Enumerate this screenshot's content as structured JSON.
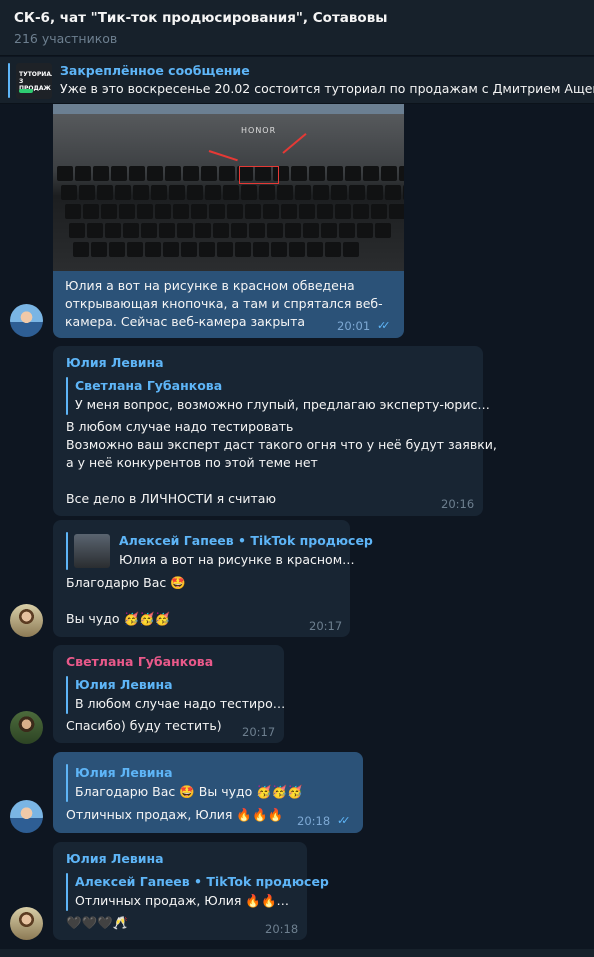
{
  "header": {
    "title": "СК-6, чат \"Тик-ток продюсирования\", Сотавовы",
    "members": "216 участников"
  },
  "pinned": {
    "label": "Закреплённое сообщение",
    "text": "Уже в это воскресенье 20.02 состоится туториал по продажам с Дмитрием Ащепковым",
    "thumb_text": "ТУТОРИАЛ\nЗ ПРОДАЖ"
  },
  "photo": {
    "brand": "HONOR"
  },
  "messages": [
    {
      "type": "outgoing-photo",
      "lines": [
        "Юлия а вот на рисунке в красном обведена",
        "открывающая кнопочка, а там и спрятался веб-",
        "камера. Сейчас веб-камера закрыта"
      ],
      "time": "20:01"
    },
    {
      "author": "Юлия Левина",
      "reply_author": "Светлана Губанкова",
      "reply_text": "У меня вопрос, возможно глупый, предлагаю эксперту-юрис…",
      "lines": [
        "В любом случае надо тестировать",
        "Возможно ваш эксперт даст такого огня что у неё будут заявки,",
        "а у неё конкурентов по этой теме нет",
        "",
        "Все дело в ЛИЧНОСТИ я считаю"
      ],
      "time": "20:16"
    },
    {
      "reply_author": "Алексей Гапеев • TikTok продюсер",
      "reply_text": "Юлия а вот на рисунке в красном…",
      "lines": [
        "Благодарю Вас 🤩",
        "",
        "Вы чудо 🥳🥳🥳"
      ],
      "time": "20:17"
    },
    {
      "author": "Светлана Губанкова",
      "author_color": "#e9598a",
      "reply_author": "Юлия Левина",
      "reply_text": "В любом случае надо тестиро…",
      "lines": [
        "Спасибо) буду тестить)"
      ],
      "time": "20:17"
    },
    {
      "reply_author": "Юлия Левина",
      "reply_text": "Благодарю Вас 🤩  Вы чудо 🥳🥳🥳",
      "lines": [
        "Отличных продаж, Юлия 🔥🔥🔥"
      ],
      "time": "20:18"
    },
    {
      "author": "Юлия Левина",
      "reply_author": "Алексей Гапеев • TikTok продюсер",
      "reply_text": "Отличных продаж, Юлия 🔥🔥…",
      "lines": [
        "🖤🖤🖤🥂"
      ],
      "time": "20:18"
    }
  ],
  "colors": {
    "background": "#0e1621",
    "incoming": "#182533",
    "outgoing": "#2b5278",
    "accent": "#5eb5f7"
  }
}
